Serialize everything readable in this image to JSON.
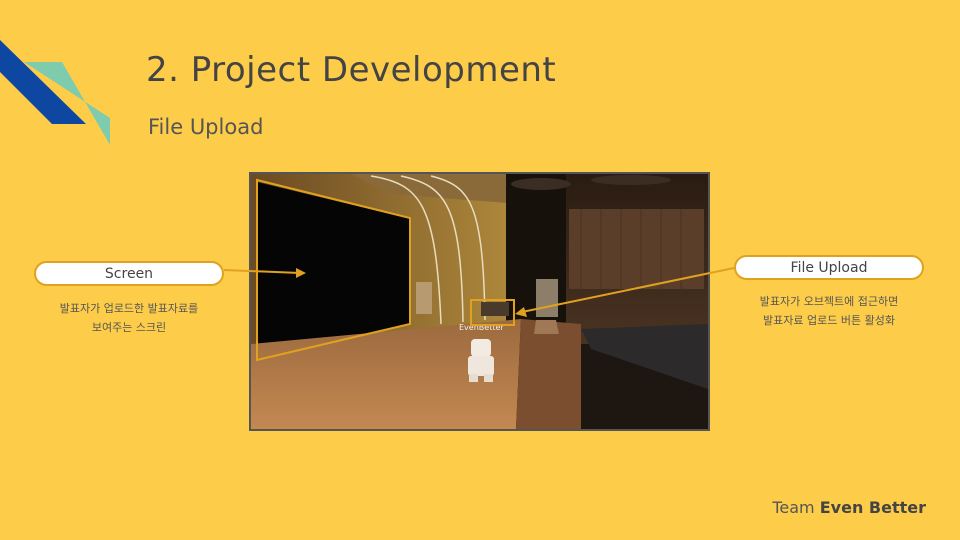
{
  "slide": {
    "title": "2. Project Development",
    "subtitle": "File Upload"
  },
  "screenshot": {
    "nametag": "EvenBetter"
  },
  "callouts": {
    "screen": {
      "label": "Screen",
      "desc_line1": "발표자가 업로드한 발표자료를",
      "desc_line2": "보여주는 스크린"
    },
    "upload": {
      "label": "File Upload",
      "desc_line1": "발표자가 오브젝트에 접근하면",
      "desc_line2": "발표자료 업로드 버튼 활성화"
    }
  },
  "footer": {
    "team": "Team",
    "name": "Even Better"
  },
  "colors": {
    "background": "#FDCD4A",
    "accent_blue": "#0E47A1",
    "accent_teal": "#7FCBAE",
    "callout_border": "#E0A21E"
  }
}
